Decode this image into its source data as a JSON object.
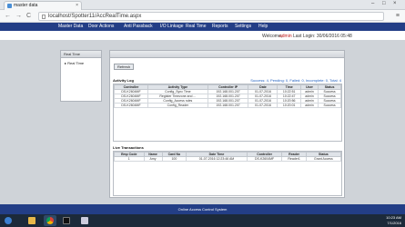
{
  "browser": {
    "tab_title": "master data",
    "tab_close": "×",
    "url": "localhost/Spotter11/AccRealTime.aspx",
    "back": "←",
    "forward": "→",
    "reload": "C",
    "menu": "≡",
    "window_controls": [
      "–",
      "□",
      "×"
    ]
  },
  "nav": {
    "items": [
      "Master Data",
      "Door Actions",
      "Anti Passback",
      "I/O Linkage",
      "Real Time",
      "Reports",
      "Settings",
      "Help"
    ]
  },
  "header": {
    "welcome_prefix": "Welcome,",
    "username": "admin",
    "last_login": "Last Login: 30/06/2016 05:48"
  },
  "sidebar": {
    "title": "Real Time",
    "items": [
      {
        "label": "Real Time"
      }
    ]
  },
  "main": {
    "refresh_label": "Refresh",
    "activity_log_title": "Activity Log",
    "activity_summary": "Success: 4, Pending: 0, Failed: 0, Incomplete: 0, Total: 4",
    "activity_columns": [
      "Controller",
      "Activity Type",
      "Controller IP",
      "Date",
      "Time",
      "User",
      "Status"
    ],
    "activity_rows": [
      [
        "DS-K2604MF",
        "Config_Sync Time",
        "192.168.001.207",
        "01-07-2016",
        "10:22:51",
        "admin",
        "Success"
      ],
      [
        "DS-K2604MF",
        "Register Timezone and ...",
        "192.168.001.207",
        "01-07-2016",
        "10:22:47",
        "admin",
        "Success"
      ],
      [
        "DS-K2604MF",
        "Config_Access rules",
        "192.168.001.207",
        "01-07-2016",
        "10:20:56",
        "admin",
        "Success"
      ],
      [
        "DS-K2604MF",
        "Config_Reader",
        "192.168.001.207",
        "01-07-2016",
        "10:20:01",
        "admin",
        "Success"
      ]
    ],
    "transactions_title": "Live Transactions",
    "transaction_columns": [
      "Emp Code",
      "Name",
      "Card No",
      "Date Time",
      "Controller",
      "Reader",
      "Status"
    ],
    "transaction_rows": [
      [
        "1",
        "Amy",
        "100",
        "01-07-2016 12:23:46 AM",
        "DS-K2604MF",
        "Reader1",
        "Grant Access"
      ]
    ]
  },
  "footer": {
    "text": "Online Access Control System"
  },
  "taskbar": {
    "time": "10:23 AM",
    "date": "7/1/2016"
  }
}
